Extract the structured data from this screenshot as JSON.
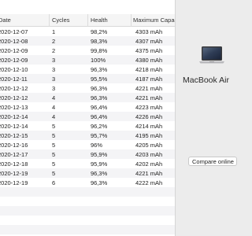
{
  "table": {
    "columns": {
      "date": "Date",
      "cycles": "Cycles",
      "health": "Health",
      "capacity": "Maximum Capacity"
    },
    "rows": [
      {
        "date": "2020-12-07",
        "cycles": "1",
        "health": "98,2%",
        "capacity": "4303 mAh"
      },
      {
        "date": "2020-12-08",
        "cycles": "2",
        "health": "98,3%",
        "capacity": "4307 mAh"
      },
      {
        "date": "2020-12-09",
        "cycles": "2",
        "health": "99,8%",
        "capacity": "4375 mAh"
      },
      {
        "date": "2020-12-09",
        "cycles": "3",
        "health": "100%",
        "capacity": "4380 mAh"
      },
      {
        "date": "2020-12-10",
        "cycles": "3",
        "health": "96,3%",
        "capacity": "4218 mAh"
      },
      {
        "date": "2020-12-11",
        "cycles": "3",
        "health": "95,5%",
        "capacity": "4187 mAh"
      },
      {
        "date": "2020-12-12",
        "cycles": "3",
        "health": "96,3%",
        "capacity": "4221 mAh"
      },
      {
        "date": "2020-12-12",
        "cycles": "4",
        "health": "96,3%",
        "capacity": "4221 mAh"
      },
      {
        "date": "2020-12-13",
        "cycles": "4",
        "health": "96,4%",
        "capacity": "4223 mAh"
      },
      {
        "date": "2020-12-14",
        "cycles": "4",
        "health": "96,4%",
        "capacity": "4226 mAh"
      },
      {
        "date": "2020-12-14",
        "cycles": "5",
        "health": "96,2%",
        "capacity": "4214 mAh"
      },
      {
        "date": "2020-12-15",
        "cycles": "5",
        "health": "95,7%",
        "capacity": "4195 mAh"
      },
      {
        "date": "2020-12-16",
        "cycles": "5",
        "health": "96%",
        "capacity": "4205 mAh"
      },
      {
        "date": "2020-12-17",
        "cycles": "5",
        "health": "95,9%",
        "capacity": "4203 mAh"
      },
      {
        "date": "2020-12-18",
        "cycles": "5",
        "health": "95,9%",
        "capacity": "4202 mAh"
      },
      {
        "date": "2020-12-19",
        "cycles": "5",
        "health": "96,3%",
        "capacity": "4221 mAh"
      },
      {
        "date": "2020-12-19",
        "cycles": "6",
        "health": "96,3%",
        "capacity": "4222 mAh"
      },
      {
        "date": "",
        "cycles": "",
        "health": "",
        "capacity": ""
      },
      {
        "date": "",
        "cycles": "",
        "health": "",
        "capacity": ""
      },
      {
        "date": "",
        "cycles": "",
        "health": "",
        "capacity": ""
      },
      {
        "date": "",
        "cycles": "",
        "health": "",
        "capacity": ""
      },
      {
        "date": "",
        "cycles": "",
        "health": "",
        "capacity": ""
      }
    ]
  },
  "device": {
    "name": "MacBook Air",
    "icon": "laptop-icon"
  },
  "actions": {
    "compare_label": "Compare online"
  }
}
